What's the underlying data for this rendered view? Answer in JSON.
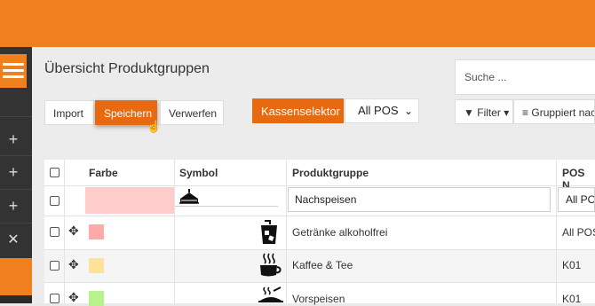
{
  "header": {
    "page_title": "Übersicht Produktgruppen"
  },
  "toolbar": {
    "import_label": "Import",
    "save_label": "Speichern",
    "discard_label": "Verwerfen",
    "cash_selector_label": "Kassenselektor",
    "pos_select_value": "All POS",
    "filter_label": "Filter",
    "group_label": "Gruppiert nac"
  },
  "search": {
    "placeholder": "Suche ..."
  },
  "table": {
    "columns": {
      "color": "Farbe",
      "symbol": "Symbol",
      "group": "Produktgruppe",
      "pos": "POS N"
    },
    "rows": [
      {
        "color": "#ffcccc",
        "symbol": "cake-icon",
        "group": "Nachspeisen",
        "pos": "All POS"
      },
      {
        "color": "#ffa9a9",
        "symbol": "cold-drink-icon",
        "group": "Getränke alkoholfrei",
        "pos": "All POS"
      },
      {
        "color": "#ffe19a",
        "symbol": "coffee-cup-icon",
        "group": "Kaffee & Tee",
        "pos": "K01"
      },
      {
        "color": "#b8f28c",
        "symbol": "serving-dish-icon",
        "group": "Vorspeisen",
        "pos": "K01"
      }
    ]
  },
  "colors": {
    "brand_orange": "#f07f1e",
    "save_button": "#e86a10",
    "sidebar": "#333333"
  }
}
